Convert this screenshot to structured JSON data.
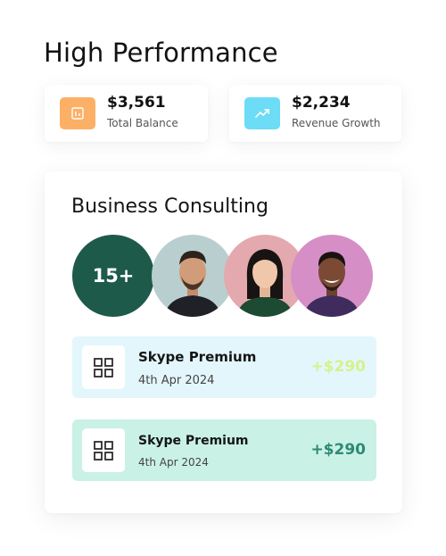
{
  "header": {
    "title": "High Performance"
  },
  "stats": [
    {
      "value": "$3,561",
      "label": "Total Balance",
      "icon": "chart-icon",
      "color": "#fcb066"
    },
    {
      "value": "$2,234",
      "label": "Revenue Growth",
      "icon": "trend-up-icon",
      "color": "#6cdcf7"
    }
  ],
  "business_card": {
    "title": "Business Consulting",
    "team_count": "15+",
    "avatars": [
      "avatar-man-beard",
      "avatar-woman",
      "avatar-man-smiling"
    ],
    "transactions": [
      {
        "name": "Skype Premium",
        "date": "4th Apr 2024",
        "amount": "+$290",
        "icon": "grid-icon"
      },
      {
        "name": "Skype Premium",
        "date": "4th Apr 2024",
        "amount": "+$290",
        "icon": "grid-icon"
      }
    ]
  },
  "colors": {
    "team_badge": "#1d5a4a",
    "transaction_1_bg": "#e3f6fc",
    "transaction_2_bg": "#caf1e6",
    "amount_1": "#d5f28c",
    "amount_2": "#2d8a73"
  }
}
